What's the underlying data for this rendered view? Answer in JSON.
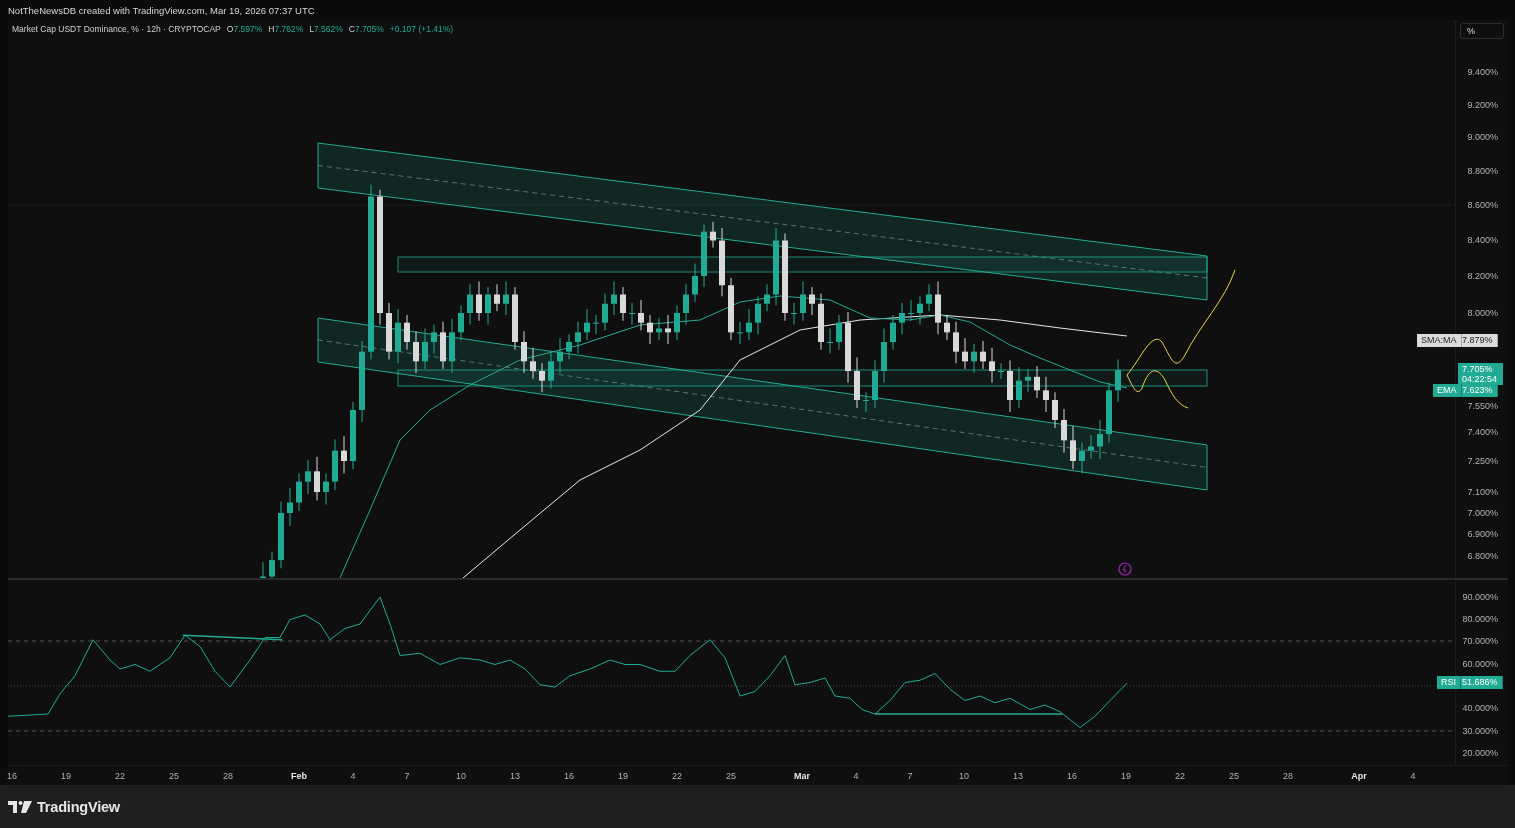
{
  "attribution": "NotTheNewsDB created with TradingView.com, Mar 19, 2026 07:37 UTC",
  "legend": {
    "symbol": "Market Cap USDT Dominance, % · 12h · CRYPTOCAP",
    "values": [
      {
        "label": "O",
        "value": "7.597%"
      },
      {
        "label": "H",
        "value": "7.762%"
      },
      {
        "label": "L",
        "value": "7.562%"
      },
      {
        "label": "C",
        "value": "7.705%"
      }
    ],
    "change": "+0.107 (+1.41%)"
  },
  "price_axis": {
    "unit_button": "%",
    "ticks": [
      "9.400%",
      "9.200%",
      "9.000%",
      "8.800%",
      "8.600%",
      "8.400%",
      "8.200%",
      "8.000%",
      "7.550%",
      "7.400%",
      "7.250%",
      "7.100%",
      "7.000%",
      "6.900%",
      "6.800%"
    ]
  },
  "badges": [
    {
      "kind": "indicator",
      "label": "SMA:MA",
      "value": "7.879%",
      "color": "#dcdcdc"
    },
    {
      "kind": "price",
      "value": "7.705%",
      "countdown": "04:22:54",
      "color": "#22ab94"
    },
    {
      "kind": "indicator",
      "label": "EMA",
      "value": "7.623%",
      "color": "#22ab94"
    }
  ],
  "rsi": {
    "ticks": [
      "90.000%",
      "80.000%",
      "70.000%",
      "60.000%",
      "40.000%",
      "30.000%",
      "20.000%"
    ],
    "badge": {
      "label": "RSI",
      "value": "51.686%",
      "color": "#22ab94"
    }
  },
  "time_axis": [
    {
      "label": "16",
      "kind": "day"
    },
    {
      "label": "19",
      "kind": "day"
    },
    {
      "label": "22",
      "kind": "day"
    },
    {
      "label": "25",
      "kind": "day"
    },
    {
      "label": "28",
      "kind": "day"
    },
    {
      "label": "Feb",
      "kind": "month"
    },
    {
      "label": "4",
      "kind": "day"
    },
    {
      "label": "7",
      "kind": "day"
    },
    {
      "label": "10",
      "kind": "day"
    },
    {
      "label": "13",
      "kind": "day"
    },
    {
      "label": "16",
      "kind": "day"
    },
    {
      "label": "19",
      "kind": "day"
    },
    {
      "label": "22",
      "kind": "day"
    },
    {
      "label": "25",
      "kind": "day"
    },
    {
      "label": "Mar",
      "kind": "month"
    },
    {
      "label": "4",
      "kind": "day"
    },
    {
      "label": "7",
      "kind": "day"
    },
    {
      "label": "10",
      "kind": "day"
    },
    {
      "label": "13",
      "kind": "day"
    },
    {
      "label": "16",
      "kind": "day"
    },
    {
      "label": "19",
      "kind": "day"
    },
    {
      "label": "22",
      "kind": "day"
    },
    {
      "label": "25",
      "kind": "day"
    },
    {
      "label": "28",
      "kind": "day"
    },
    {
      "label": "Apr",
      "kind": "month"
    },
    {
      "label": "4",
      "kind": "day"
    }
  ],
  "footer": {
    "logo_text": "TradingView"
  }
}
